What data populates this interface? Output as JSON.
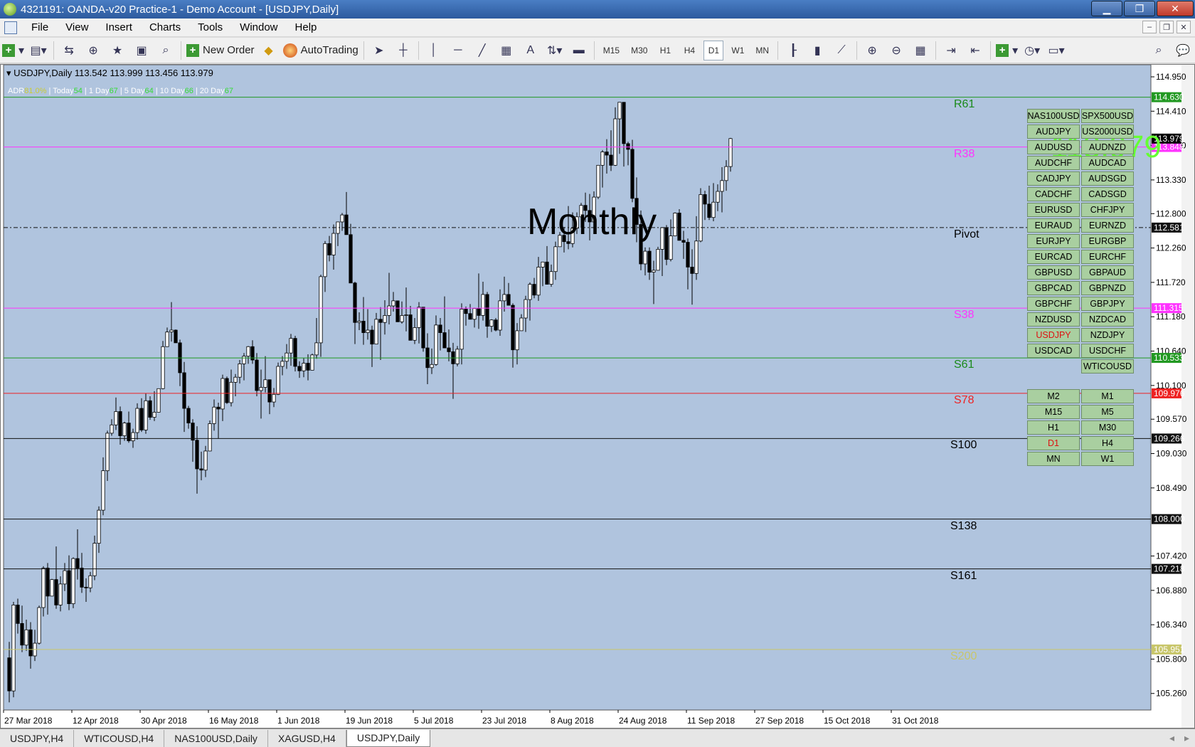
{
  "window": {
    "title": "4321191: OANDA-v20 Practice-1 - Demo Account - [USDJPY,Daily]"
  },
  "menu": [
    "File",
    "View",
    "Insert",
    "Charts",
    "Tools",
    "Window",
    "Help"
  ],
  "toolbar": {
    "new_order": "New Order",
    "autotrading": "AutoTrading",
    "timeframes": [
      "M15",
      "M30",
      "H1",
      "H4",
      "D1",
      "W1",
      "MN"
    ],
    "active_timeframe": "D1"
  },
  "chart": {
    "header": "USDJPY,Daily  113.542 113.999 113.456 113.979",
    "adr": {
      "adr_label": "ADR",
      "adr_value": "81.0%",
      "today_label": "Today",
      "today_value": "54",
      "d1_label": "1 Day",
      "d1_value": "67",
      "d5_label": "5 Day",
      "d5_value": "64",
      "d10_label": "10 Day",
      "d10_value": "66",
      "d20_label": "20 Day",
      "d20_value": "67"
    },
    "big_price": "113.979",
    "period_label": "Monthly",
    "price_axis": [
      "114.950",
      "114.410",
      "113.870",
      "113.330",
      "112.800",
      "112.260",
      "111.720",
      "111.180",
      "110.640",
      "110.100",
      "109.570",
      "109.030",
      "108.490",
      "107.420",
      "106.880",
      "106.340",
      "105.800",
      "105.260"
    ],
    "date_axis": [
      "27 Mar 2018",
      "12 Apr 2018",
      "30 Apr 2018",
      "16 May 2018",
      "1 Jun 2018",
      "19 Jun 2018",
      "5 Jul 2018",
      "23 Jul 2018",
      "8 Aug 2018",
      "24 Aug 2018",
      "11 Sep 2018",
      "27 Sep 2018",
      "15 Oct 2018",
      "31 Oct 2018"
    ],
    "levels": [
      {
        "name": "R61",
        "price": 114.63,
        "tag": "114.630",
        "line_color": "#229922",
        "label_color": "#1a8a1a",
        "tag_bg": "#229922",
        "style": "solid"
      },
      {
        "name": "R38",
        "price": 113.848,
        "tag": "113.848",
        "line_color": "#ff33ff",
        "label_color": "#ff33ff",
        "tag_bg": "#ff33ff",
        "style": "solid"
      },
      {
        "name": "Pivot",
        "price": 112.581,
        "tag": "112.581",
        "line_color": "#111111",
        "label_color": "#000000",
        "tag_bg": "#111111",
        "style": "dashdot"
      },
      {
        "name": "S38",
        "price": 111.315,
        "tag": "111.315",
        "line_color": "#ff33ff",
        "label_color": "#ff33ff",
        "tag_bg": "#ff33ff",
        "style": "solid"
      },
      {
        "name": "S61",
        "price": 110.533,
        "tag": "110.533",
        "line_color": "#229922",
        "label_color": "#1a8a1a",
        "tag_bg": "#229922",
        "style": "solid"
      },
      {
        "name": "S78",
        "price": 109.976,
        "tag": "109.976",
        "line_color": "#ee2222",
        "label_color": "#ee2222",
        "tag_bg": "#ee2222",
        "style": "solid"
      },
      {
        "name": "S100",
        "price": 109.266,
        "tag": "109.266",
        "line_color": "#111111",
        "label_color": "#000000",
        "tag_bg": "#111111",
        "style": "solid"
      },
      {
        "name": "S138",
        "price": 108.0,
        "tag": "108.000",
        "line_color": "#111111",
        "label_color": "#000000",
        "tag_bg": "#111111",
        "style": "solid"
      },
      {
        "name": "S161",
        "price": 107.218,
        "tag": "107.218",
        "line_color": "#111111",
        "label_color": "#000000",
        "tag_bg": "#111111",
        "style": "solid"
      },
      {
        "name": "S200",
        "price": 105.951,
        "tag": "105.951",
        "line_color": "#c8c66a",
        "label_color": "#c8c66a",
        "tag_bg": "#c8c66a",
        "style": "solid"
      }
    ],
    "current_price": {
      "price": 113.979,
      "tag": "113.979"
    }
  },
  "symbol_buttons": [
    [
      "NAS100USD",
      "SPX500USD"
    ],
    [
      "AUDJPY",
      "US2000USD"
    ],
    [
      "AUDUSD",
      "AUDNZD"
    ],
    [
      "AUDCHF",
      "AUDCAD"
    ],
    [
      "CADJPY",
      "AUDSGD"
    ],
    [
      "CADCHF",
      "CADSGD"
    ],
    [
      "EURUSD",
      "CHFJPY"
    ],
    [
      "EURAUD",
      "EURNZD"
    ],
    [
      "EURJPY",
      "EURGBP"
    ],
    [
      "EURCAD",
      "EURCHF"
    ],
    [
      "GBPUSD",
      "GBPAUD"
    ],
    [
      "GBPCAD",
      "GBPNZD"
    ],
    [
      "GBPCHF",
      "GBPJPY"
    ],
    [
      "NZDUSD",
      "NZDCAD"
    ],
    [
      "USDJPY",
      "NZDJPY"
    ],
    [
      "USDCAD",
      "USDCHF"
    ],
    [
      "",
      "WTICOUSD"
    ]
  ],
  "active_symbol": "USDJPY",
  "timeframe_buttons": [
    [
      "M2",
      "M1"
    ],
    [
      "M15",
      "M5"
    ],
    [
      "H1",
      "M30"
    ],
    [
      "D1",
      "H4"
    ],
    [
      "MN",
      "W1"
    ]
  ],
  "tabs": [
    "USDJPY,H4",
    "WTICOUSD,H4",
    "NAS100USD,Daily",
    "XAGUSD,H4",
    "USDJPY,Daily"
  ],
  "active_tab": "USDJPY,Daily",
  "colors": {
    "chart_bg": "#b0c4de",
    "bull": "#ffffff",
    "bear": "#000000",
    "button_green": "#a9cfa0"
  },
  "chart_data": {
    "type": "candlestick",
    "symbol": "USDJPY",
    "timeframe": "Daily",
    "ylim": [
      105.0,
      115.14
    ],
    "ohlc": [
      [
        105.82,
        106.07,
        105.12,
        105.3
      ],
      [
        105.3,
        106.7,
        105.2,
        106.65
      ],
      [
        106.65,
        106.75,
        106.2,
        106.36
      ],
      [
        106.36,
        106.64,
        105.91,
        106.02
      ],
      [
        106.02,
        106.42,
        105.93,
        106.26
      ],
      [
        106.26,
        106.38,
        105.65,
        105.85
      ],
      [
        105.85,
        106.26,
        105.77,
        106.05
      ],
      [
        106.05,
        106.64,
        106.03,
        106.61
      ],
      [
        106.61,
        107.26,
        106.47,
        107.23
      ],
      [
        107.23,
        107.31,
        106.5,
        106.79
      ],
      [
        106.79,
        107.06,
        106.79,
        107.05
      ],
      [
        107.05,
        107.57,
        106.59,
        106.65
      ],
      [
        106.65,
        107.1,
        106.55,
        106.98
      ],
      [
        106.98,
        107.31,
        106.87,
        107.19
      ],
      [
        107.19,
        107.43,
        106.57,
        106.67
      ],
      [
        106.67,
        107.4,
        106.6,
        107.38
      ],
      [
        107.38,
        107.84,
        107.05,
        107.23
      ],
      [
        107.23,
        107.47,
        106.84,
        106.93
      ],
      [
        106.93,
        107.07,
        106.7,
        106.92
      ],
      [
        106.92,
        107.17,
        106.85,
        107.11
      ],
      [
        107.11,
        107.74,
        107.04,
        107.62
      ],
      [
        107.62,
        108.2,
        107.47,
        108.14
      ],
      [
        108.14,
        108.97,
        108.06,
        108.76
      ],
      [
        108.76,
        109.39,
        108.6,
        109.35
      ],
      [
        109.35,
        109.57,
        109.31,
        109.48
      ],
      [
        109.48,
        109.91,
        109.4,
        109.69
      ],
      [
        109.69,
        109.77,
        109.17,
        109.31
      ],
      [
        109.31,
        109.53,
        109.23,
        109.51
      ],
      [
        109.51,
        109.69,
        109.2,
        109.23
      ],
      [
        109.23,
        109.42,
        109.12,
        109.36
      ],
      [
        109.36,
        109.82,
        109.25,
        109.74
      ],
      [
        109.74,
        109.9,
        109.37,
        109.4
      ],
      [
        109.4,
        109.98,
        109.34,
        109.86
      ],
      [
        109.86,
        109.93,
        109.56,
        109.6
      ],
      [
        109.6,
        110.01,
        109.54,
        109.68
      ],
      [
        109.68,
        110.05,
        109.69,
        110.05
      ],
      [
        110.05,
        110.8,
        110.04,
        110.71
      ],
      [
        110.71,
        111.01,
        110.82,
        110.94
      ],
      [
        110.94,
        111.41,
        110.79,
        110.97
      ],
      [
        110.97,
        110.98,
        110.99,
        110.77
      ],
      [
        110.77,
        110.82,
        110.09,
        110.3
      ],
      [
        110.3,
        110.47,
        109.37,
        109.74
      ],
      [
        109.74,
        109.78,
        109.42,
        109.51
      ],
      [
        109.51,
        109.57,
        108.9,
        109.24
      ],
      [
        109.24,
        109.46,
        108.4,
        108.79
      ],
      [
        108.79,
        109.06,
        108.61,
        108.77
      ],
      [
        108.77,
        109.15,
        108.66,
        109.07
      ],
      [
        109.07,
        109.55,
        109.07,
        109.5
      ],
      [
        109.5,
        109.88,
        109.39,
        109.76
      ],
      [
        109.76,
        109.83,
        109.27,
        109.73
      ],
      [
        109.73,
        110.27,
        109.54,
        110.21
      ],
      [
        110.21,
        110.24,
        109.81,
        109.83
      ],
      [
        109.83,
        110.35,
        109.77,
        110.15
      ],
      [
        110.15,
        110.28,
        109.93,
        110.23
      ],
      [
        110.23,
        110.5,
        110.13,
        110.44
      ],
      [
        110.44,
        110.61,
        110.18,
        110.56
      ],
      [
        110.56,
        110.72,
        110.44,
        110.71
      ],
      [
        110.71,
        110.81,
        110.44,
        110.5
      ],
      [
        110.5,
        110.61,
        109.93,
        110.02
      ],
      [
        110.02,
        110.35,
        109.58,
        110.07
      ],
      [
        110.07,
        110.56,
        109.99,
        110.19
      ],
      [
        110.19,
        110.18,
        109.65,
        109.84
      ],
      [
        109.84,
        110.06,
        109.76,
        109.96
      ],
      [
        109.96,
        110.46,
        109.95,
        110.4
      ],
      [
        110.4,
        110.56,
        110.26,
        110.48
      ],
      [
        110.48,
        110.75,
        110.36,
        110.61
      ],
      [
        110.61,
        110.91,
        110.41,
        110.84
      ],
      [
        110.84,
        110.88,
        110.32,
        110.4
      ],
      [
        110.4,
        110.48,
        110.22,
        110.33
      ],
      [
        110.33,
        110.53,
        110.23,
        110.45
      ],
      [
        110.45,
        110.59,
        110.18,
        110.34
      ],
      [
        110.34,
        110.6,
        110.34,
        110.58
      ],
      [
        110.58,
        111.16,
        110.52,
        110.77
      ],
      [
        110.77,
        111.84,
        110.55,
        111.81
      ],
      [
        111.81,
        112.37,
        111.57,
        112.33
      ],
      [
        112.33,
        112.45,
        112.05,
        112.15
      ],
      [
        112.15,
        112.63,
        111.92,
        112.49
      ],
      [
        112.49,
        112.67,
        112.29,
        112.67
      ],
      [
        112.67,
        112.81,
        112.53,
        112.78
      ],
      [
        112.78,
        113.14,
        112.57,
        112.47
      ],
      [
        112.47,
        112.64,
        111.84,
        111.71
      ],
      [
        111.71,
        111.73,
        110.75,
        111.09
      ],
      [
        111.09,
        111.25,
        110.97,
        111.11
      ],
      [
        111.11,
        111.49,
        110.74,
        110.93
      ],
      [
        110.93,
        111.3,
        110.82,
        110.97
      ],
      [
        110.97,
        111.04,
        110.39,
        110.75
      ],
      [
        110.75,
        111.24,
        110.9,
        111.14
      ],
      [
        111.14,
        111.33,
        110.5,
        111.09
      ],
      [
        111.09,
        111.44,
        110.9,
        111.2
      ],
      [
        111.2,
        111.87,
        111.06,
        111.35
      ],
      [
        111.35,
        111.57,
        111.26,
        111.43
      ],
      [
        111.43,
        111.35,
        111.12,
        111.1
      ],
      [
        111.1,
        111.42,
        111.07,
        111.2
      ],
      [
        111.2,
        111.64,
        110.95,
        111.21
      ],
      [
        111.21,
        111.35,
        110.83,
        110.81
      ],
      [
        110.81,
        111.16,
        110.75,
        111.01
      ],
      [
        111.01,
        111.41,
        110.76,
        111.33
      ],
      [
        111.33,
        111.25,
        110.63,
        110.69
      ],
      [
        110.69,
        110.92,
        110.12,
        110.38
      ],
      [
        110.38,
        110.68,
        110.28,
        110.43
      ],
      [
        110.43,
        111.2,
        110.41,
        111.05
      ],
      [
        111.05,
        111.16,
        110.65,
        110.93
      ],
      [
        110.93,
        111.5,
        110.82,
        110.69
      ],
      [
        110.69,
        110.98,
        110.48,
        110.63
      ],
      [
        110.63,
        110.77,
        109.89,
        110.44
      ],
      [
        110.44,
        110.72,
        110.4,
        110.67
      ],
      [
        110.67,
        111.39,
        110.43,
        111.3
      ],
      [
        111.3,
        111.34,
        111.04,
        111.23
      ],
      [
        111.23,
        111.38,
        111.14,
        111.14
      ],
      [
        111.14,
        111.32,
        111.01,
        111.31
      ],
      [
        111.31,
        111.86,
        110.99,
        111.2
      ],
      [
        111.2,
        111.73,
        111.12,
        111.53
      ],
      [
        111.53,
        111.57,
        110.85,
        111.03
      ],
      [
        111.03,
        111.14,
        110.94,
        111.13
      ],
      [
        111.13,
        111.16,
        110.95,
        110.97
      ],
      [
        110.97,
        111.61,
        110.88,
        111.43
      ],
      [
        111.43,
        111.81,
        111.26,
        111.53
      ],
      [
        111.53,
        111.71,
        111.43,
        111.36
      ],
      [
        111.36,
        111.39,
        110.38,
        110.66
      ],
      [
        110.66,
        111.08,
        110.43,
        110.96
      ],
      [
        110.96,
        111.22,
        110.96,
        111.16
      ],
      [
        111.16,
        111.51,
        110.94,
        111.45
      ],
      [
        111.45,
        111.72,
        111.12,
        111.69
      ],
      [
        111.69,
        111.79,
        111.47,
        111.52
      ],
      [
        111.52,
        112.12,
        111.43,
        111.96
      ],
      [
        111.96,
        112.02,
        111.66,
        112.04
      ],
      [
        112.04,
        112.29,
        111.69,
        111.69
      ],
      [
        111.69,
        112.0,
        111.65,
        111.89
      ],
      [
        111.89,
        112.36,
        111.76,
        112.28
      ],
      [
        112.28,
        112.51,
        112.29,
        112.46
      ],
      [
        112.46,
        112.59,
        112.19,
        112.36
      ],
      [
        112.36,
        112.92,
        112.24,
        112.33
      ],
      [
        112.33,
        112.82,
        112.27,
        112.57
      ],
      [
        112.57,
        112.82,
        112.48,
        112.75
      ],
      [
        112.75,
        112.97,
        112.58,
        112.93
      ],
      [
        112.93,
        113.13,
        112.67,
        112.85
      ],
      [
        112.85,
        113.11,
        112.38,
        112.67
      ],
      [
        112.67,
        113.15,
        112.62,
        113.06
      ],
      [
        113.06,
        113.56,
        113.03,
        113.56
      ],
      [
        113.56,
        113.8,
        113.21,
        113.77
      ],
      [
        113.77,
        113.97,
        113.43,
        113.72
      ],
      [
        113.72,
        114.11,
        113.47,
        113.56
      ],
      [
        113.56,
        114.47,
        113.55,
        114.29
      ],
      [
        114.29,
        114.52,
        113.74,
        114.55
      ],
      [
        114.55,
        114.51,
        113.54,
        113.9
      ],
      [
        113.9,
        113.93,
        113.56,
        113.81
      ],
      [
        113.81,
        113.96,
        112.98,
        113.04
      ],
      [
        113.04,
        113.37,
        112.35,
        112.63
      ],
      [
        112.63,
        112.85,
        111.91,
        112.01
      ],
      [
        112.01,
        112.27,
        111.83,
        112.21
      ],
      [
        112.21,
        112.27,
        111.76,
        111.88
      ],
      [
        111.88,
        112.06,
        111.38,
        111.91
      ],
      [
        111.91,
        112.28,
        111.95,
        112.24
      ],
      [
        112.24,
        112.49,
        111.82,
        112.58
      ],
      [
        112.58,
        112.62,
        111.99,
        112.08
      ],
      [
        112.08,
        112.71,
        112.05,
        112.45
      ],
      [
        112.45,
        112.82,
        112.45,
        112.81
      ],
      [
        112.81,
        112.87,
        112.55,
        112.38
      ],
      [
        112.38,
        112.53,
        112.09,
        112.35
      ],
      [
        112.35,
        112.41,
        111.61,
        111.96
      ],
      [
        111.96,
        112.24,
        111.37,
        111.86
      ],
      [
        111.86,
        112.76,
        111.76,
        112.37
      ],
      [
        112.37,
        113.2,
        112.35,
        113.1
      ],
      [
        113.1,
        113.16,
        112.7,
        112.95
      ],
      [
        112.95,
        113.24,
        112.7,
        112.74
      ],
      [
        112.74,
        113.28,
        112.68,
        112.98
      ],
      [
        112.98,
        113.26,
        112.84,
        113.15
      ],
      [
        113.15,
        113.53,
        112.82,
        113.32
      ],
      [
        113.32,
        113.64,
        113.16,
        113.54
      ],
      [
        113.54,
        113.99,
        113.46,
        113.98
      ]
    ]
  }
}
